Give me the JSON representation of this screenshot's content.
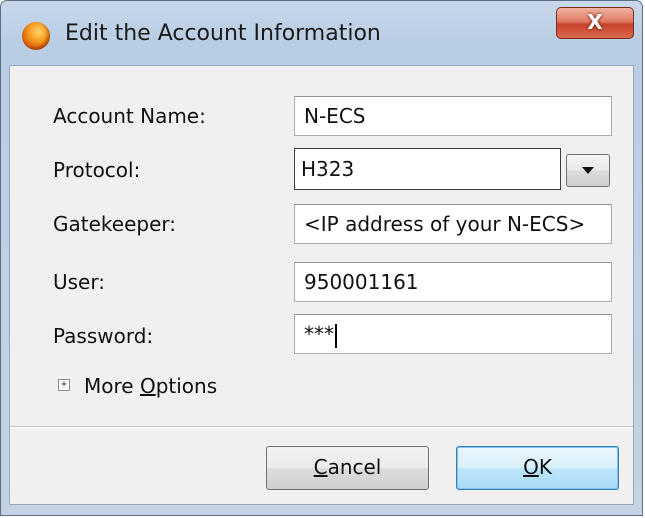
{
  "window": {
    "title": "Edit the Account Information",
    "app_icon": "orange-orb-icon",
    "close_symbol": "X"
  },
  "form": {
    "account_name": {
      "label": "Account Name:",
      "value": "N-ECS"
    },
    "protocol": {
      "label": "Protocol:",
      "value": "H323"
    },
    "gatekeeper": {
      "label": "Gatekeeper:",
      "value": "<IP address of your N-ECS>"
    },
    "user": {
      "label": "User:",
      "value": "950001161"
    },
    "password": {
      "label": "Password:",
      "value": "***"
    }
  },
  "more_options": {
    "expand_symbol": "+",
    "label_prefix": "More ",
    "label_accel": "O",
    "label_rest": "ptions"
  },
  "buttons": {
    "cancel": {
      "accel": "C",
      "rest": "ancel"
    },
    "ok": {
      "accel": "O",
      "rest": "K"
    }
  },
  "colors": {
    "titlebar": "#b9cde3",
    "close_button": "#c8412a",
    "ok_button_border": "#3c7fb1"
  }
}
